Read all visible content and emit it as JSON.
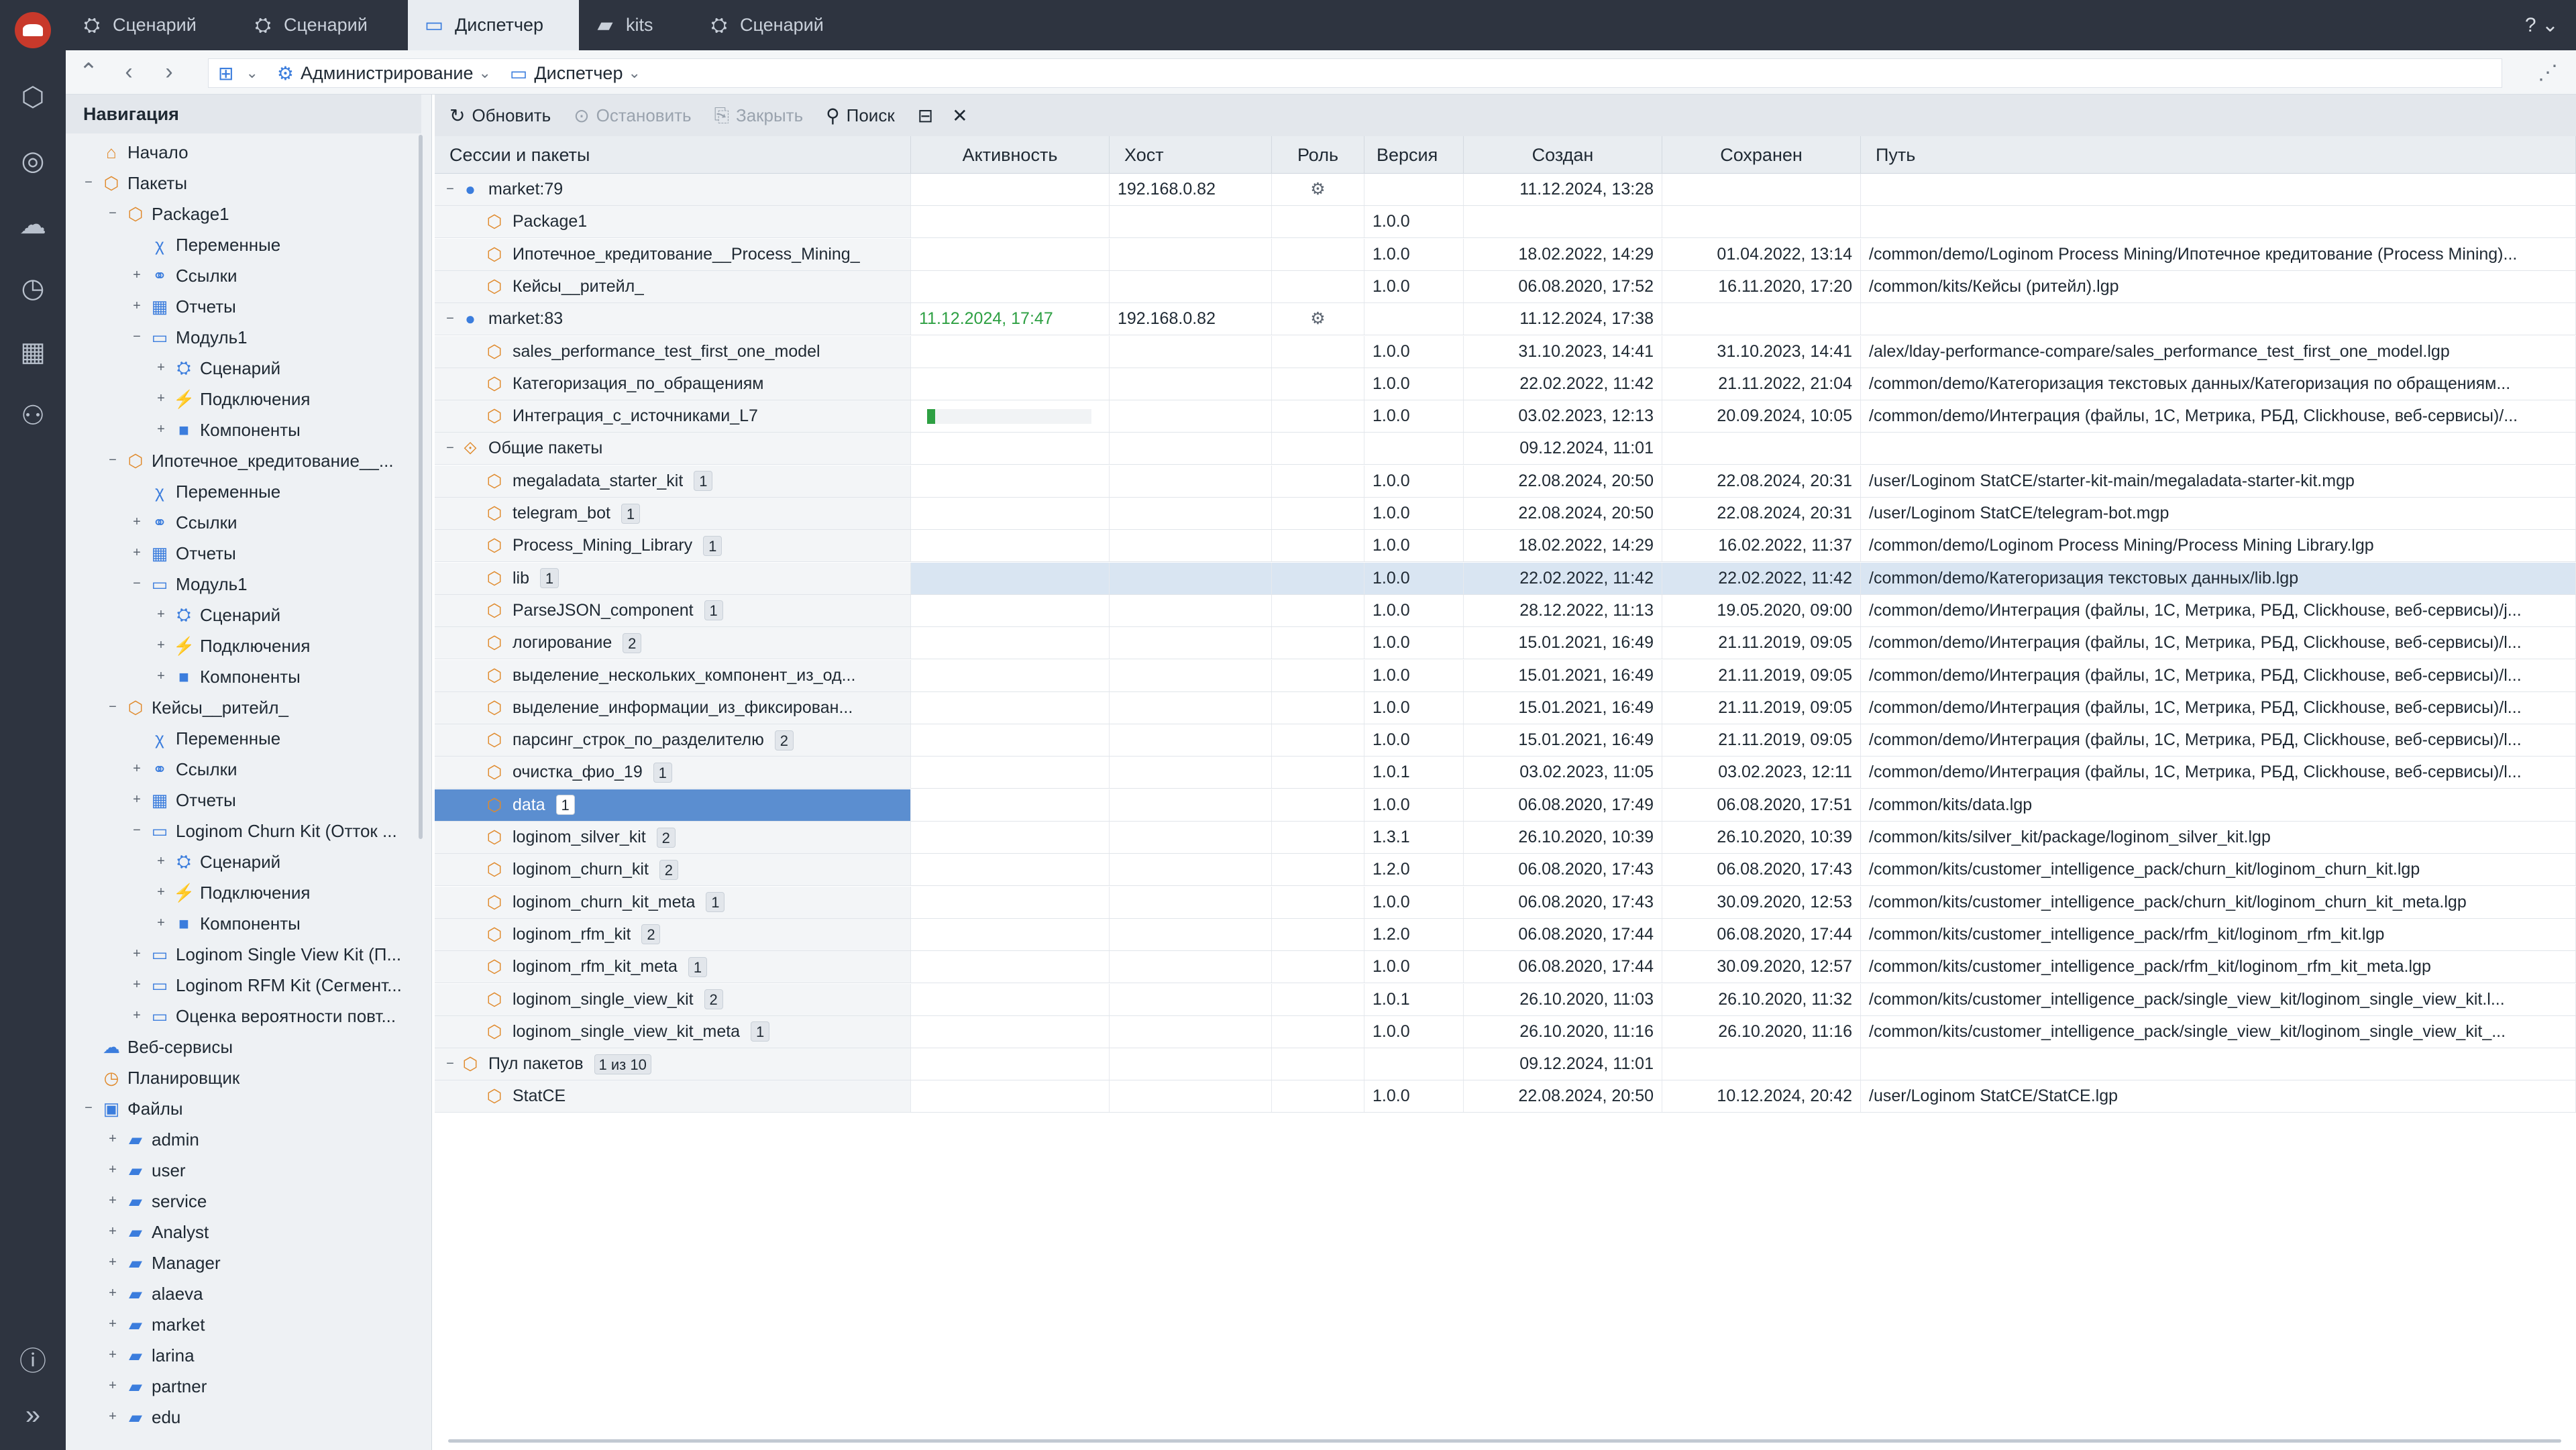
{
  "tabs": [
    {
      "label": "Сценарий",
      "icon": "scenario-icon"
    },
    {
      "label": "Сценарий",
      "icon": "scenario-icon"
    },
    {
      "label": "Диспетчер",
      "icon": "dispatcher-icon"
    },
    {
      "label": "kits",
      "icon": "folder-icon"
    },
    {
      "label": "Сценарий",
      "icon": "scenario-icon"
    }
  ],
  "breadcrumb": [
    {
      "label": "Администрирование"
    },
    {
      "label": "Диспетчер"
    }
  ],
  "nav": {
    "title": "Навигация",
    "items": [
      {
        "label": "Начало"
      },
      {
        "label": "Пакеты"
      },
      {
        "label": "Package1"
      },
      {
        "label": "Переменные"
      },
      {
        "label": "Ссылки"
      },
      {
        "label": "Отчеты"
      },
      {
        "label": "Модуль1"
      },
      {
        "label": "Сценарий"
      },
      {
        "label": "Подключения"
      },
      {
        "label": "Компоненты"
      },
      {
        "label": "Ипотечное_кредитование__..."
      },
      {
        "label": "Переменные"
      },
      {
        "label": "Ссылки"
      },
      {
        "label": "Отчеты"
      },
      {
        "label": "Модуль1"
      },
      {
        "label": "Сценарий"
      },
      {
        "label": "Подключения"
      },
      {
        "label": "Компоненты"
      },
      {
        "label": "Кейсы__ритейл_"
      },
      {
        "label": "Переменные"
      },
      {
        "label": "Ссылки"
      },
      {
        "label": "Отчеты"
      },
      {
        "label": "Loginom Churn Kit (Отток ..."
      },
      {
        "label": "Сценарий"
      },
      {
        "label": "Подключения"
      },
      {
        "label": "Компоненты"
      },
      {
        "label": "Loginom Single View Kit (П..."
      },
      {
        "label": "Loginom RFM Kit (Сегмент..."
      },
      {
        "label": "Оценка вероятности повт..."
      },
      {
        "label": "Веб-сервисы"
      },
      {
        "label": "Планировщик"
      },
      {
        "label": "Файлы"
      },
      {
        "label": "admin"
      },
      {
        "label": "user"
      },
      {
        "label": "service"
      },
      {
        "label": "Analyst"
      },
      {
        "label": "Manager"
      },
      {
        "label": "alaeva"
      },
      {
        "label": "market"
      },
      {
        "label": "larina"
      },
      {
        "label": "partner"
      },
      {
        "label": "edu"
      }
    ]
  },
  "toolbar": {
    "refresh": "Обновить",
    "stop": "Остановить",
    "close": "Закрыть",
    "search": "Поиск"
  },
  "columns": [
    "Сессии и пакеты",
    "Активность",
    "Хост",
    "Роль",
    "Версия",
    "Создан",
    "Сохранен",
    "Путь"
  ],
  "rows": [
    {
      "name": "market:79",
      "activity": "",
      "host": "192.168.0.82",
      "role": "⚙",
      "version": "",
      "created": "11.12.2024, 13:28",
      "saved": "",
      "path": "",
      "badge": ""
    },
    {
      "name": "Package1",
      "activity": "",
      "host": "",
      "role": "",
      "version": "1.0.0",
      "created": "",
      "saved": "",
      "path": "",
      "badge": ""
    },
    {
      "name": "Ипотечное_кредитование__Process_Mining_",
      "activity": "",
      "host": "",
      "role": "",
      "version": "1.0.0",
      "created": "18.02.2022, 14:29",
      "saved": "01.04.2022, 13:14",
      "path": "/common/demo/Loginom Process Mining/Ипотечное кредитование (Process Mining)...",
      "badge": ""
    },
    {
      "name": "Кейсы__ритейл_",
      "activity": "",
      "host": "",
      "role": "",
      "version": "1.0.0",
      "created": "06.08.2020, 17:52",
      "saved": "16.11.2020, 17:20",
      "path": "/common/kits/Кейсы (ритейл).lgp",
      "badge": ""
    },
    {
      "name": "market:83",
      "activity": "11.12.2024, 17:47",
      "host": "192.168.0.82",
      "role": "⚙",
      "version": "",
      "created": "11.12.2024, 17:38",
      "saved": "",
      "path": "",
      "badge": ""
    },
    {
      "name": "sales_performance_test_first_one_model",
      "activity": "",
      "host": "",
      "role": "",
      "version": "1.0.0",
      "created": "31.10.2023, 14:41",
      "saved": "31.10.2023, 14:41",
      "path": "/alex/lday-performance-compare/sales_performance_test_first_one_model.lgp",
      "badge": ""
    },
    {
      "name": "Категоризация_по_обращениям",
      "activity": "",
      "host": "",
      "role": "",
      "version": "1.0.0",
      "created": "22.02.2022, 11:42",
      "saved": "21.11.2022, 21:04",
      "path": "/common/demo/Категоризация текстовых данных/Категоризация по обращениям...",
      "badge": ""
    },
    {
      "name": "Интеграция_с_источниками_L7",
      "activity": "",
      "host": "",
      "role": "",
      "version": "1.0.0",
      "created": "03.02.2023, 12:13",
      "saved": "20.09.2024, 10:05",
      "path": "/common/demo/Интеграция (файлы, 1С, Метрика, РБД, Clickhouse, веб-сервисы)/...",
      "badge": "",
      "progress": 0.05
    },
    {
      "name": "Общие пакеты",
      "activity": "",
      "host": "",
      "role": "",
      "version": "",
      "created": "09.12.2024, 11:01",
      "saved": "",
      "path": "",
      "badge": ""
    },
    {
      "name": "megaladata_starter_kit",
      "activity": "",
      "host": "",
      "role": "",
      "version": "1.0.0",
      "created": "22.08.2024, 20:50",
      "saved": "22.08.2024, 20:31",
      "path": "/user/Loginom StatCE/starter-kit-main/megaladata-starter-kit.mgp",
      "badge": "1"
    },
    {
      "name": "telegram_bot",
      "activity": "",
      "host": "",
      "role": "",
      "version": "1.0.0",
      "created": "22.08.2024, 20:50",
      "saved": "22.08.2024, 20:31",
      "path": "/user/Loginom StatCE/telegram-bot.mgp",
      "badge": "1"
    },
    {
      "name": "Process_Mining_Library",
      "activity": "",
      "host": "",
      "role": "",
      "version": "1.0.0",
      "created": "18.02.2022, 14:29",
      "saved": "16.02.2022, 11:37",
      "path": "/common/demo/Loginom Process Mining/Process Mining Library.lgp",
      "badge": "1"
    },
    {
      "name": "lib",
      "activity": "",
      "host": "",
      "role": "",
      "version": "1.0.0",
      "created": "22.02.2022, 11:42",
      "saved": "22.02.2022, 11:42",
      "path": "/common/demo/Категоризация текстовых данных/lib.lgp",
      "badge": "1"
    },
    {
      "name": "ParseJSON_component",
      "activity": "",
      "host": "",
      "role": "",
      "version": "1.0.0",
      "created": "28.12.2022, 11:13",
      "saved": "19.05.2020, 09:00",
      "path": "/common/demo/Интеграция (файлы, 1С, Метрика, РБД, Clickhouse, веб-сервисы)/j...",
      "badge": "1"
    },
    {
      "name": "логирование",
      "activity": "",
      "host": "",
      "role": "",
      "version": "1.0.0",
      "created": "15.01.2021, 16:49",
      "saved": "21.11.2019, 09:05",
      "path": "/common/demo/Интеграция (файлы, 1С, Метрика, РБД, Clickhouse, веб-сервисы)/l...",
      "badge": "2"
    },
    {
      "name": "выделение_нескольких_компонент_из_од...",
      "activity": "",
      "host": "",
      "role": "",
      "version": "1.0.0",
      "created": "15.01.2021, 16:49",
      "saved": "21.11.2019, 09:05",
      "path": "/common/demo/Интеграция (файлы, 1С, Метрика, РБД, Clickhouse, веб-сервисы)/l...",
      "badge": ""
    },
    {
      "name": "выделение_информации_из_фиксирован...",
      "activity": "",
      "host": "",
      "role": "",
      "version": "1.0.0",
      "created": "15.01.2021, 16:49",
      "saved": "21.11.2019, 09:05",
      "path": "/common/demo/Интеграция (файлы, 1С, Метрика, РБД, Clickhouse, веб-сервисы)/l...",
      "badge": ""
    },
    {
      "name": "парсинг_строк_по_разделителю",
      "activity": "",
      "host": "",
      "role": "",
      "version": "1.0.0",
      "created": "15.01.2021, 16:49",
      "saved": "21.11.2019, 09:05",
      "path": "/common/demo/Интеграция (файлы, 1С, Метрика, РБД, Clickhouse, веб-сервисы)/l...",
      "badge": "2"
    },
    {
      "name": "очистка_фио_19",
      "activity": "",
      "host": "",
      "role": "",
      "version": "1.0.1",
      "created": "03.02.2023, 11:05",
      "saved": "03.02.2023, 12:11",
      "path": "/common/demo/Интеграция (файлы, 1С, Метрика, РБД, Clickhouse, веб-сервисы)/l...",
      "badge": "1"
    },
    {
      "name": "data",
      "activity": "",
      "host": "",
      "role": "",
      "version": "1.0.0",
      "created": "06.08.2020, 17:49",
      "saved": "06.08.2020, 17:51",
      "path": "/common/kits/data.lgp",
      "badge": "1"
    },
    {
      "name": "loginom_silver_kit",
      "activity": "",
      "host": "",
      "role": "",
      "version": "1.3.1",
      "created": "26.10.2020, 10:39",
      "saved": "26.10.2020, 10:39",
      "path": "/common/kits/silver_kit/package/loginom_silver_kit.lgp",
      "badge": "2"
    },
    {
      "name": "loginom_churn_kit",
      "activity": "",
      "host": "",
      "role": "",
      "version": "1.2.0",
      "created": "06.08.2020, 17:43",
      "saved": "06.08.2020, 17:43",
      "path": "/common/kits/customer_intelligence_pack/churn_kit/loginom_churn_kit.lgp",
      "badge": "2"
    },
    {
      "name": "loginom_churn_kit_meta",
      "activity": "",
      "host": "",
      "role": "",
      "version": "1.0.0",
      "created": "06.08.2020, 17:43",
      "saved": "30.09.2020, 12:53",
      "path": "/common/kits/customer_intelligence_pack/churn_kit/loginom_churn_kit_meta.lgp",
      "badge": "1"
    },
    {
      "name": "loginom_rfm_kit",
      "activity": "",
      "host": "",
      "role": "",
      "version": "1.2.0",
      "created": "06.08.2020, 17:44",
      "saved": "06.08.2020, 17:44",
      "path": "/common/kits/customer_intelligence_pack/rfm_kit/loginom_rfm_kit.lgp",
      "badge": "2"
    },
    {
      "name": "loginom_rfm_kit_meta",
      "activity": "",
      "host": "",
      "role": "",
      "version": "1.0.0",
      "created": "06.08.2020, 17:44",
      "saved": "30.09.2020, 12:57",
      "path": "/common/kits/customer_intelligence_pack/rfm_kit/loginom_rfm_kit_meta.lgp",
      "badge": "1"
    },
    {
      "name": "loginom_single_view_kit",
      "activity": "",
      "host": "",
      "role": "",
      "version": "1.0.1",
      "created": "26.10.2020, 11:03",
      "saved": "26.10.2020, 11:32",
      "path": "/common/kits/customer_intelligence_pack/single_view_kit/loginom_single_view_kit.l...",
      "badge": "2"
    },
    {
      "name": "loginom_single_view_kit_meta",
      "activity": "",
      "host": "",
      "role": "",
      "version": "1.0.0",
      "created": "26.10.2020, 11:16",
      "saved": "26.10.2020, 11:16",
      "path": "/common/kits/customer_intelligence_pack/single_view_kit/loginom_single_view_kit_...",
      "badge": "1"
    },
    {
      "name": "Пул пакетов",
      "activity": "",
      "host": "",
      "role": "",
      "version": "",
      "created": "09.12.2024, 11:01",
      "saved": "",
      "path": "",
      "badge": "1 из 10"
    },
    {
      "name": "StatCE",
      "activity": "",
      "host": "",
      "role": "",
      "version": "1.0.0",
      "created": "22.08.2024, 20:50",
      "saved": "10.12.2024, 20:42",
      "path": "/user/Loginom StatCE/StatCE.lgp",
      "badge": ""
    }
  ],
  "colors": {
    "chrome": "#2e3440",
    "accent": "#3b7ddd",
    "selected_row": "#5b8ed0",
    "activity_green": "#2ea043",
    "package_orange": "#e08a2c"
  }
}
